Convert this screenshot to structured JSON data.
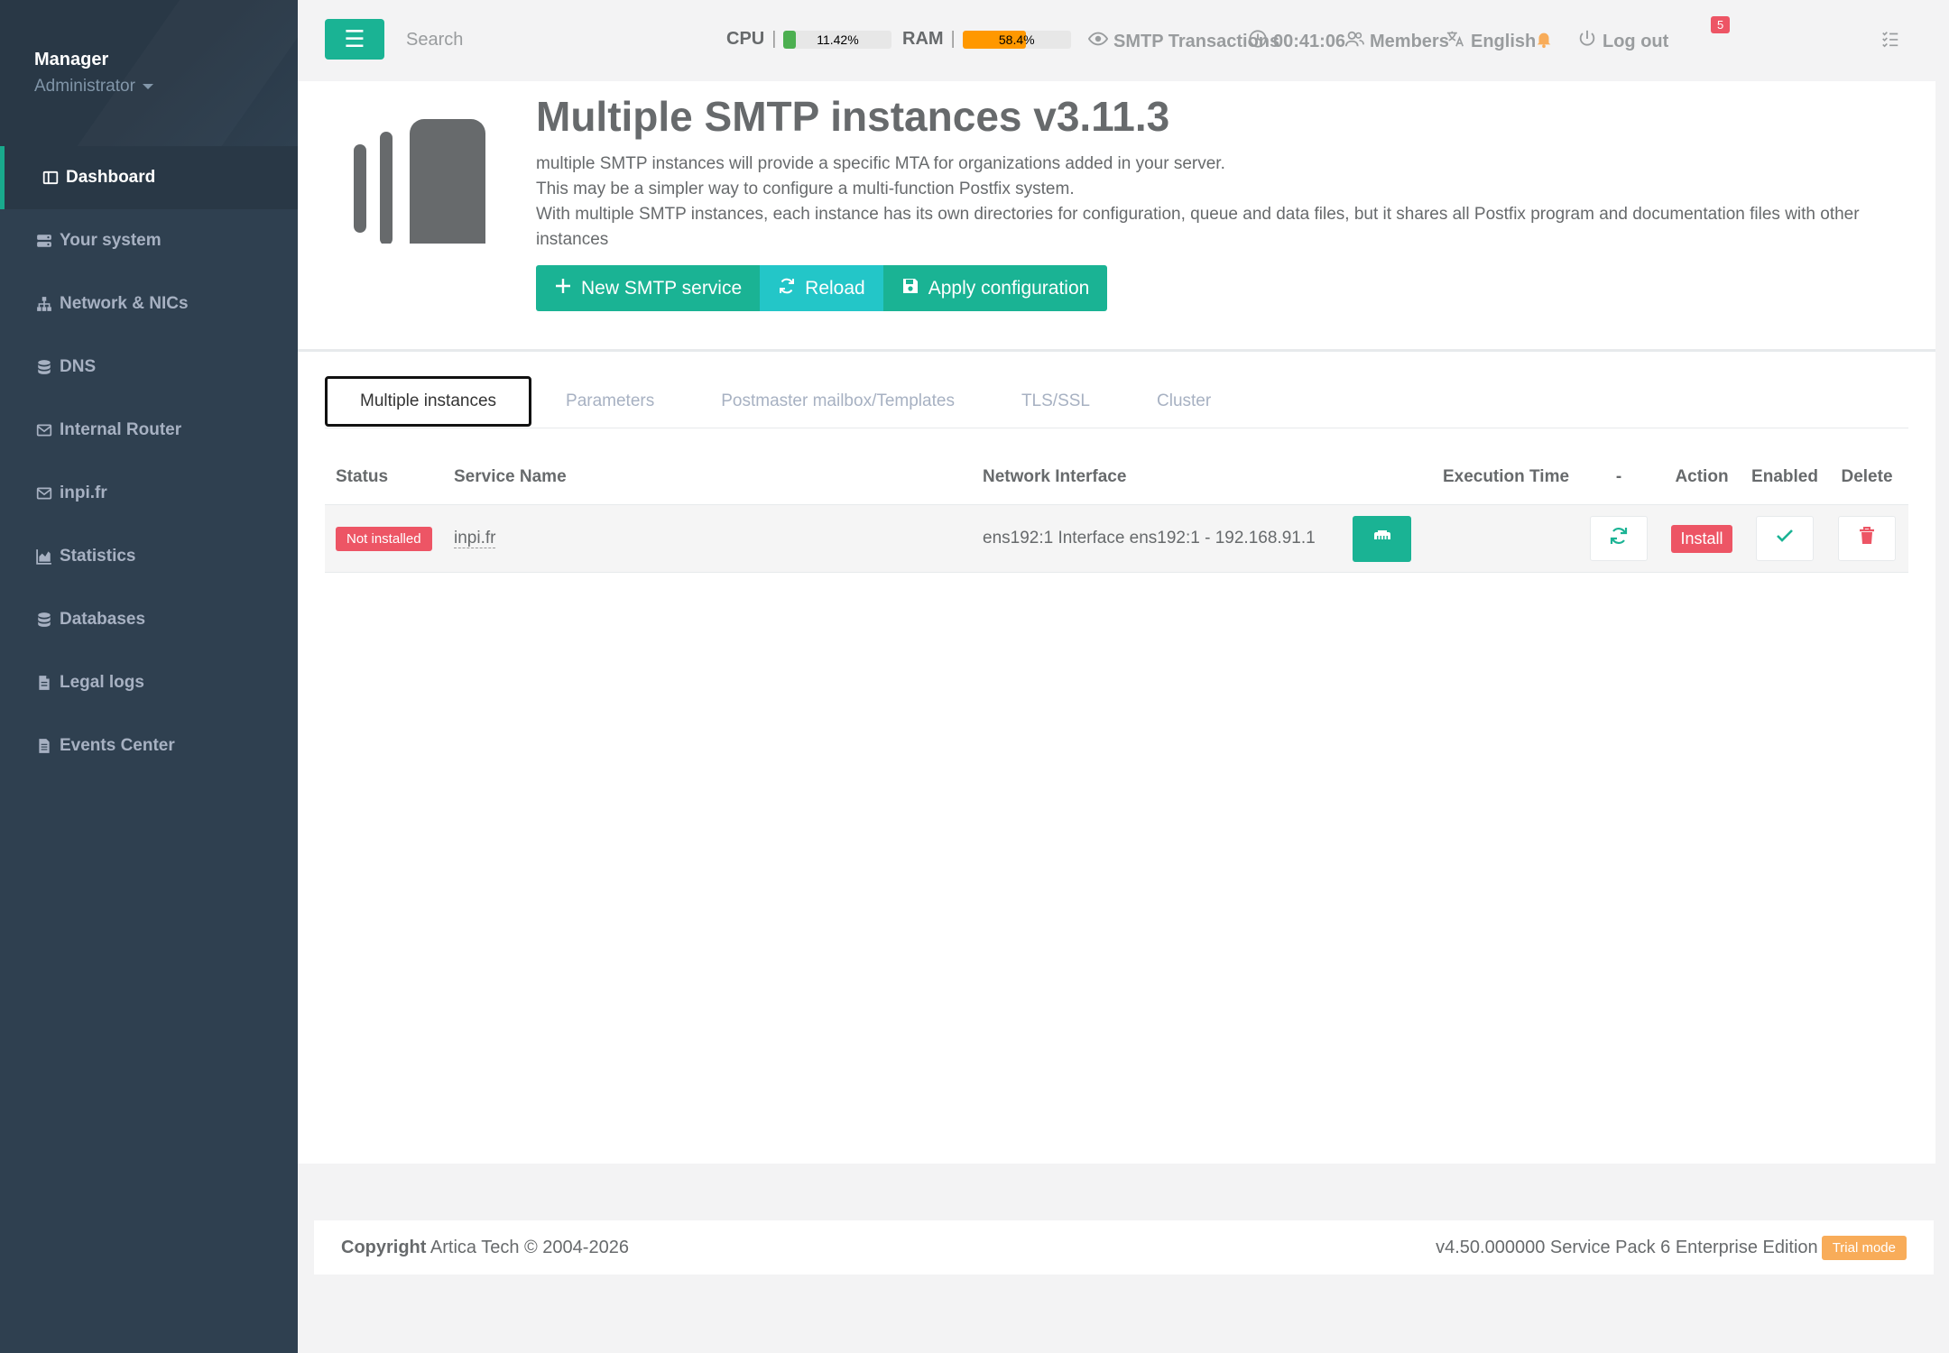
{
  "sidebar": {
    "profile_name": "Manager",
    "profile_role": "Administrator",
    "items": [
      {
        "label": "Dashboard",
        "icon": "dashboard-icon"
      },
      {
        "label": "Your system",
        "icon": "server-icon"
      },
      {
        "label": "Network & NICs",
        "icon": "network-icon"
      },
      {
        "label": "DNS",
        "icon": "database-icon"
      },
      {
        "label": "Internal Router",
        "icon": "envelope-icon"
      },
      {
        "label": "inpi.fr",
        "icon": "envelope-icon"
      },
      {
        "label": "Statistics",
        "icon": "area-chart-icon"
      },
      {
        "label": "Databases",
        "icon": "database-icon"
      },
      {
        "label": "Legal logs",
        "icon": "file-icon"
      },
      {
        "label": "Events Center",
        "icon": "file-text-icon"
      }
    ]
  },
  "topbar": {
    "search_placeholder": "Search",
    "cpu_label": "CPU",
    "cpu_value": "11.42%",
    "cpu_level": 0.1142,
    "ram_label": "RAM",
    "ram_value": "58.4%",
    "ram_level": 0.584,
    "smtp_transactions": "SMTP Transactions",
    "clock": "00:41:06",
    "members": "Members",
    "language": "English",
    "notifications_count": "5",
    "logout": "Log out"
  },
  "header": {
    "title": "Multiple SMTP instances v3.11.3",
    "desc_line1": "multiple SMTP instances will provide a specific MTA for organizations added in your server.",
    "desc_line2": "This may be a simpler way to configure a multi-function Postfix system.",
    "desc_line3": "With multiple SMTP instances, each instance has its own directories for configuration, queue and data files, but it shares all Postfix program and documentation files with other instances",
    "btn_new": "New SMTP service",
    "btn_reload": "Reload",
    "btn_apply": "Apply configuration"
  },
  "tabs": [
    "Multiple instances",
    "Parameters",
    "Postmaster mailbox/Templates",
    "TLS/SSL",
    "Cluster"
  ],
  "table": {
    "headers": {
      "status": "Status",
      "service_name": "Service Name",
      "network_interface": "Network Interface",
      "execution_time": "Execution Time",
      "dash": "-",
      "action": "Action",
      "enabled": "Enabled",
      "delete": "Delete"
    },
    "rows": [
      {
        "status": "Not installed",
        "service_name": "inpi.fr",
        "network_interface": "ens192:1 Interface ens192:1 - 192.168.91.1",
        "execution_time": "",
        "action": "Install"
      }
    ]
  },
  "footer": {
    "copyright_bold": "Copyright",
    "copyright_text": "Artica Tech © 2004-2026",
    "version": "v4.50.000000 Service Pack 6 Enterprise Edition",
    "trial": "Trial mode"
  },
  "colors": {
    "sidebar_bg": "#2f4050",
    "primary": "#1ab394",
    "info": "#23c6c8",
    "danger": "#ed5565",
    "warning": "#f8ac59",
    "cpu_bar": "#4caf50",
    "ram_bar": "#ff9800"
  }
}
